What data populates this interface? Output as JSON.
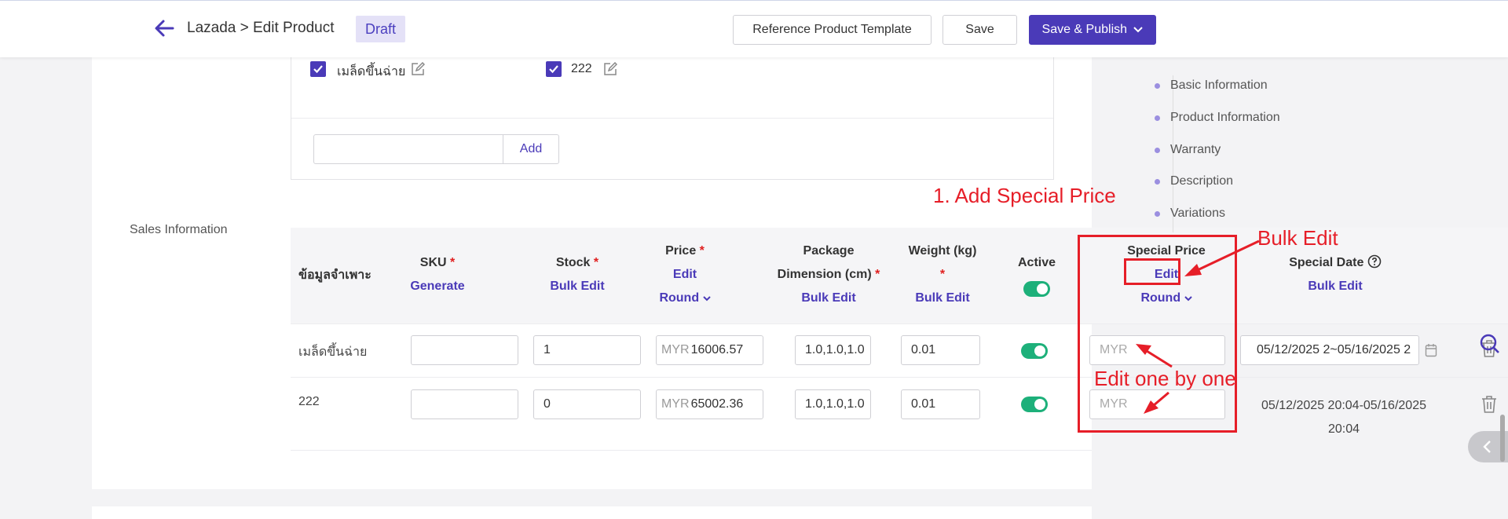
{
  "header": {
    "breadcrumb": "Lazada > Edit Product",
    "status_badge": "Draft",
    "reference_button": "Reference Product Template",
    "save_button": "Save",
    "publish_button": "Save & Publish"
  },
  "variations": {
    "options": [
      {
        "label": "เมล็ดขึ้นฉ่าย",
        "checked": true
      },
      {
        "label": "222",
        "checked": true
      }
    ],
    "add_input_value": "",
    "add_button": "Add"
  },
  "sales": {
    "section_label": "Sales Information",
    "columns": {
      "spec": "ข้อมูลจำเพาะ",
      "sku": "SKU",
      "sku_action": "Generate",
      "stock": "Stock",
      "stock_action": "Bulk Edit",
      "price": "Price",
      "price_action": "Edit",
      "price_round": "Round",
      "package_line1": "Package",
      "package_line2": "Dimension (cm)",
      "package_action": "Bulk Edit",
      "weight": "Weight (kg)",
      "weight_action": "Bulk Edit",
      "active": "Active",
      "special_price": "Special Price",
      "special_price_action": "Edit",
      "special_price_round": "Round",
      "special_date": "Special Date",
      "special_date_action": "Bulk Edit",
      "required_mark": "*"
    },
    "rows": [
      {
        "spec": "เมล็ดขึ้นฉ่าย",
        "sku": "",
        "stock": "1",
        "price_currency": "MYR",
        "price": "16006.57",
        "package": "1.0,1.0,1.0",
        "weight": "0.01",
        "active": true,
        "special_price_placeholder": "MYR",
        "special_date": "05/12/2025 2~05/16/2025 2"
      },
      {
        "spec": "222",
        "sku": "",
        "stock": "0",
        "price_currency": "MYR",
        "price": "65002.36",
        "package": "1.0,1.0,1.0",
        "weight": "0.01",
        "active": true,
        "special_price_placeholder": "MYR",
        "special_date_line1": "05/12/2025 20:04-05/16/2025",
        "special_date_line2": "20:04"
      }
    ]
  },
  "nav": {
    "items": [
      "Basic Information",
      "Product Information",
      "Warranty",
      "Description",
      "Variations"
    ]
  },
  "annotations": {
    "step1": "1. Add Special Price",
    "bulk_edit": "Bulk Edit",
    "one_by_one": "Edit one by one",
    "color": "#e61e28"
  },
  "colors": {
    "accent": "#4a3ab8",
    "toggle_on": "#1db07a",
    "required": "#e02020"
  }
}
